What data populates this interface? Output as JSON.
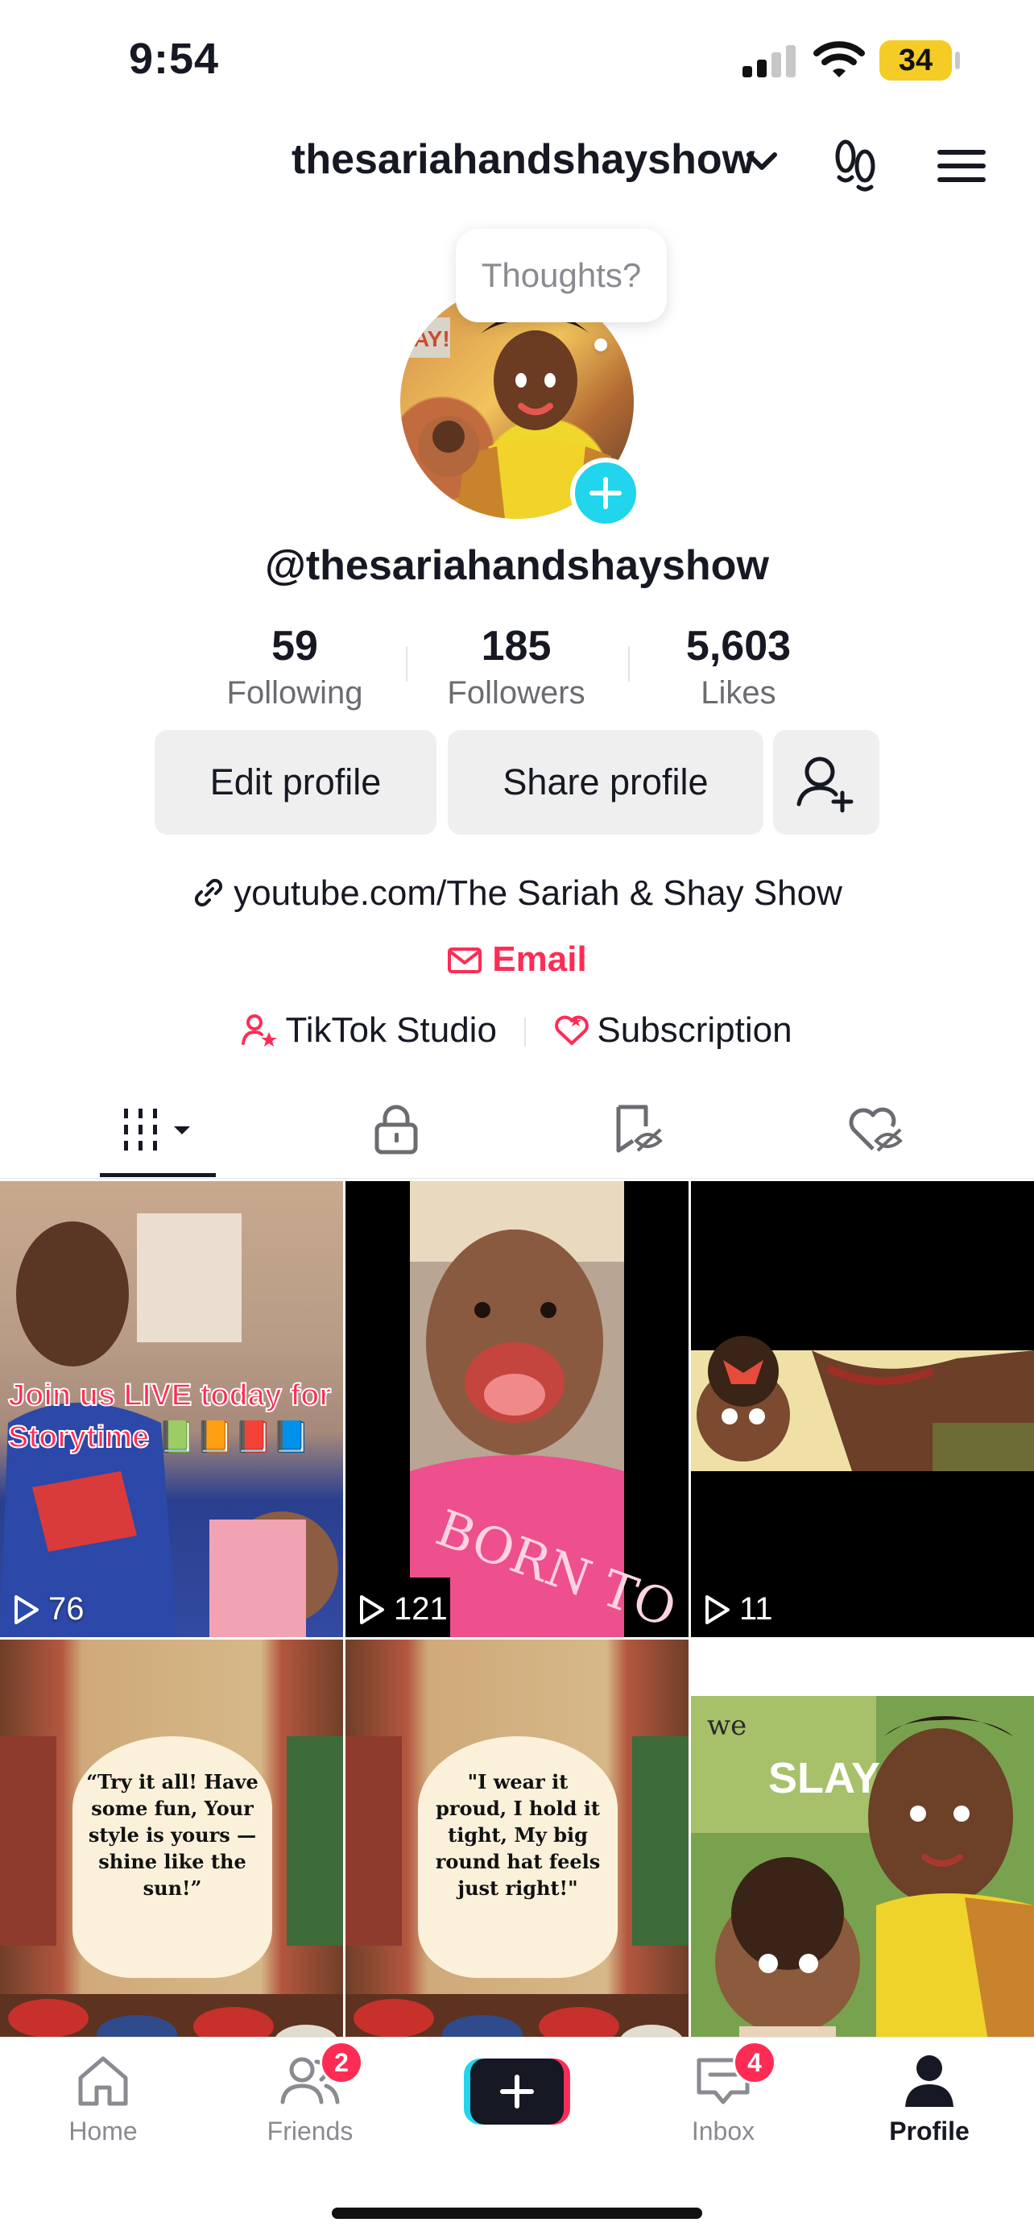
{
  "status_bar": {
    "time": "9:54",
    "battery": "34"
  },
  "header": {
    "username": "thesariahandshayshow"
  },
  "thoughts_bubble": "Thoughts?",
  "profile": {
    "handle": "@thesariahandshayshow",
    "stats": [
      {
        "value": "59",
        "label": "Following"
      },
      {
        "value": "185",
        "label": "Followers"
      },
      {
        "value": "5,603",
        "label": "Likes"
      }
    ],
    "buttons": {
      "edit": "Edit profile",
      "share": "Share profile"
    },
    "link": "youtube.com/The Sariah & Shay Show",
    "email": "Email",
    "studio": "TikTok Studio",
    "subscription": "Subscription"
  },
  "videos": [
    {
      "views": "76",
      "overlay_line1": "Join us LIVE today for",
      "overlay_line2": "Storytime 📗📙📕📘"
    },
    {
      "views": "121",
      "shirt_text": "BORN TO"
    },
    {
      "views": "11"
    },
    {
      "card_text": "“Try it all! Have some fun, Your style is yours —shine like the sun!”"
    },
    {
      "card_text": "\"I wear it proud, I hold it tight, My big round hat feels just right!\""
    },
    {
      "slay_text": "SLAY!",
      "top_text": "we"
    }
  ],
  "nav": {
    "home": "Home",
    "friends": "Friends",
    "friends_badge": "2",
    "inbox": "Inbox",
    "inbox_badge": "4",
    "profile": "Profile"
  },
  "colors": {
    "accent": "#fe2c55",
    "cyan": "#20d5ec",
    "battery": "#f4cc25"
  }
}
